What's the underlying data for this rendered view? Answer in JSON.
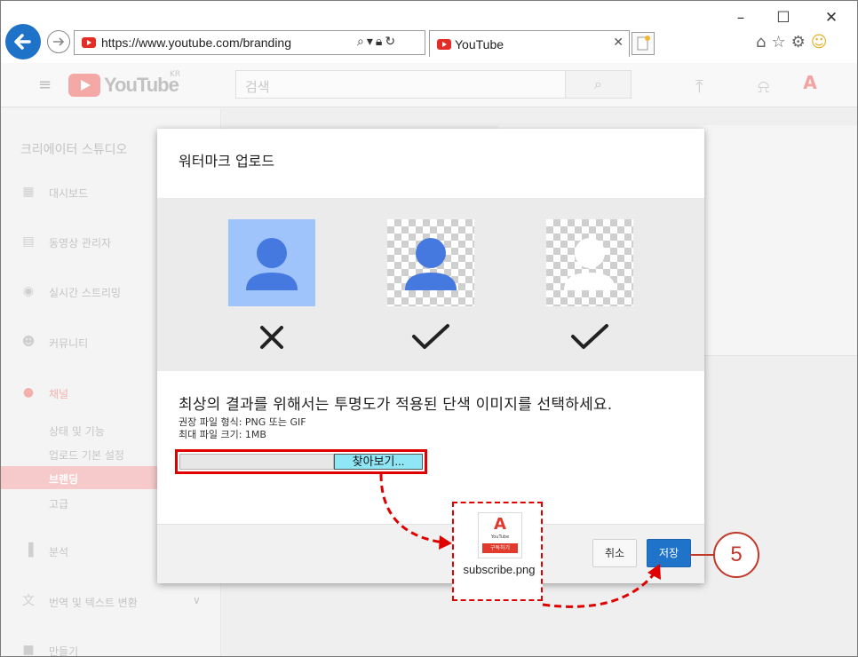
{
  "browser": {
    "url": "https://www.youtube.com/branding",
    "tab_title": "YouTube",
    "window_controls": [
      "–",
      "☐",
      "✕"
    ]
  },
  "youtube": {
    "logo": "YouTube",
    "region": "KR",
    "search_placeholder": "검색",
    "search_icon": "search-icon",
    "sidebar": {
      "title": "크리에이터 스튜디오",
      "items": [
        {
          "label": "대시보드",
          "icon": "dashboard-icon"
        },
        {
          "label": "동영상 관리자",
          "icon": "video-manager-icon"
        },
        {
          "label": "실시간 스트리밍",
          "icon": "live-icon"
        },
        {
          "label": "커뮤니티",
          "icon": "community-icon"
        },
        {
          "label": "채널",
          "icon": "channel-icon"
        },
        {
          "label": "분석",
          "icon": "analytics-icon"
        },
        {
          "label": "번역 및 텍스트 변환",
          "icon": "translate-icon"
        },
        {
          "label": "만들기",
          "icon": "create-icon"
        }
      ],
      "channel_subitems": [
        "상태 및 기능",
        "업로드 기본 설정",
        "브랜딩",
        "고급"
      ],
      "active_subitem": "브랜딩"
    }
  },
  "dialog": {
    "title": "워터마크 업로드",
    "headline": "최상의 결과를 위해서는 투명도가 적용된 단색 이미지를 선택하세요.",
    "format_hint": "권장 파일 형식: PNG 또는 GIF",
    "size_hint": "최대 파일 크기: 1MB",
    "browse_label": "찾아보기...",
    "cancel_label": "취소",
    "save_label": "저장",
    "examples": [
      {
        "background": "solid",
        "valid": false
      },
      {
        "background": "transparent-dark",
        "valid": true
      },
      {
        "background": "transparent-white",
        "valid": true
      }
    ]
  },
  "annotation": {
    "file_name": "subscribe.png",
    "thumb_text": "구독하기",
    "thumb_brand": "YouTube",
    "step_number": "5",
    "accent_color": "#e00000"
  },
  "colors": {
    "accent_blue": "#1f73c9",
    "youtube_red": "#e52d27",
    "preview_blue": "#4579e0"
  }
}
